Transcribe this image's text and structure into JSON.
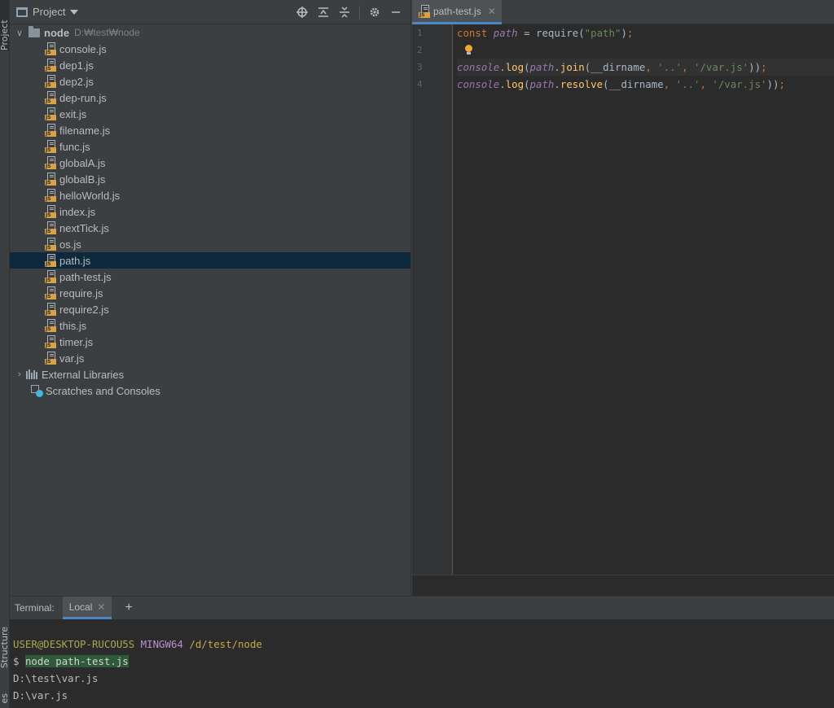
{
  "stripe": {
    "project_tab": "Project",
    "structure_tab": "Structure",
    "favorites_tab": "es"
  },
  "project_panel": {
    "title": "Project",
    "root": {
      "name": "node",
      "path": "D:₩test₩node"
    },
    "files": [
      "console.js",
      "dep1.js",
      "dep2.js",
      "dep-run.js",
      "exit.js",
      "filename.js",
      "func.js",
      "globalA.js",
      "globalB.js",
      "helloWorld.js",
      "index.js",
      "nextTick.js",
      "os.js",
      "path.js",
      "path-test.js",
      "require.js",
      "require2.js",
      "this.js",
      "timer.js",
      "var.js"
    ],
    "selected_file": "path.js",
    "external_libraries": "External Libraries",
    "scratches": "Scratches and Consoles",
    "icons": {
      "js_badge": "JS"
    }
  },
  "editor": {
    "tab_label": "path-test.js",
    "line_numbers": [
      "1",
      "2",
      "3",
      "4"
    ]
  },
  "terminal": {
    "label": "Terminal:",
    "tab": "Local",
    "prompt_user": "USER@DESKTOP-RUCOU5S",
    "prompt_env": "MINGW64",
    "prompt_dir": "/d/test/node",
    "dollar": "$",
    "command": "node path-test.js",
    "output": [
      "D:\\test\\var.js",
      "D:\\var.js"
    ]
  }
}
